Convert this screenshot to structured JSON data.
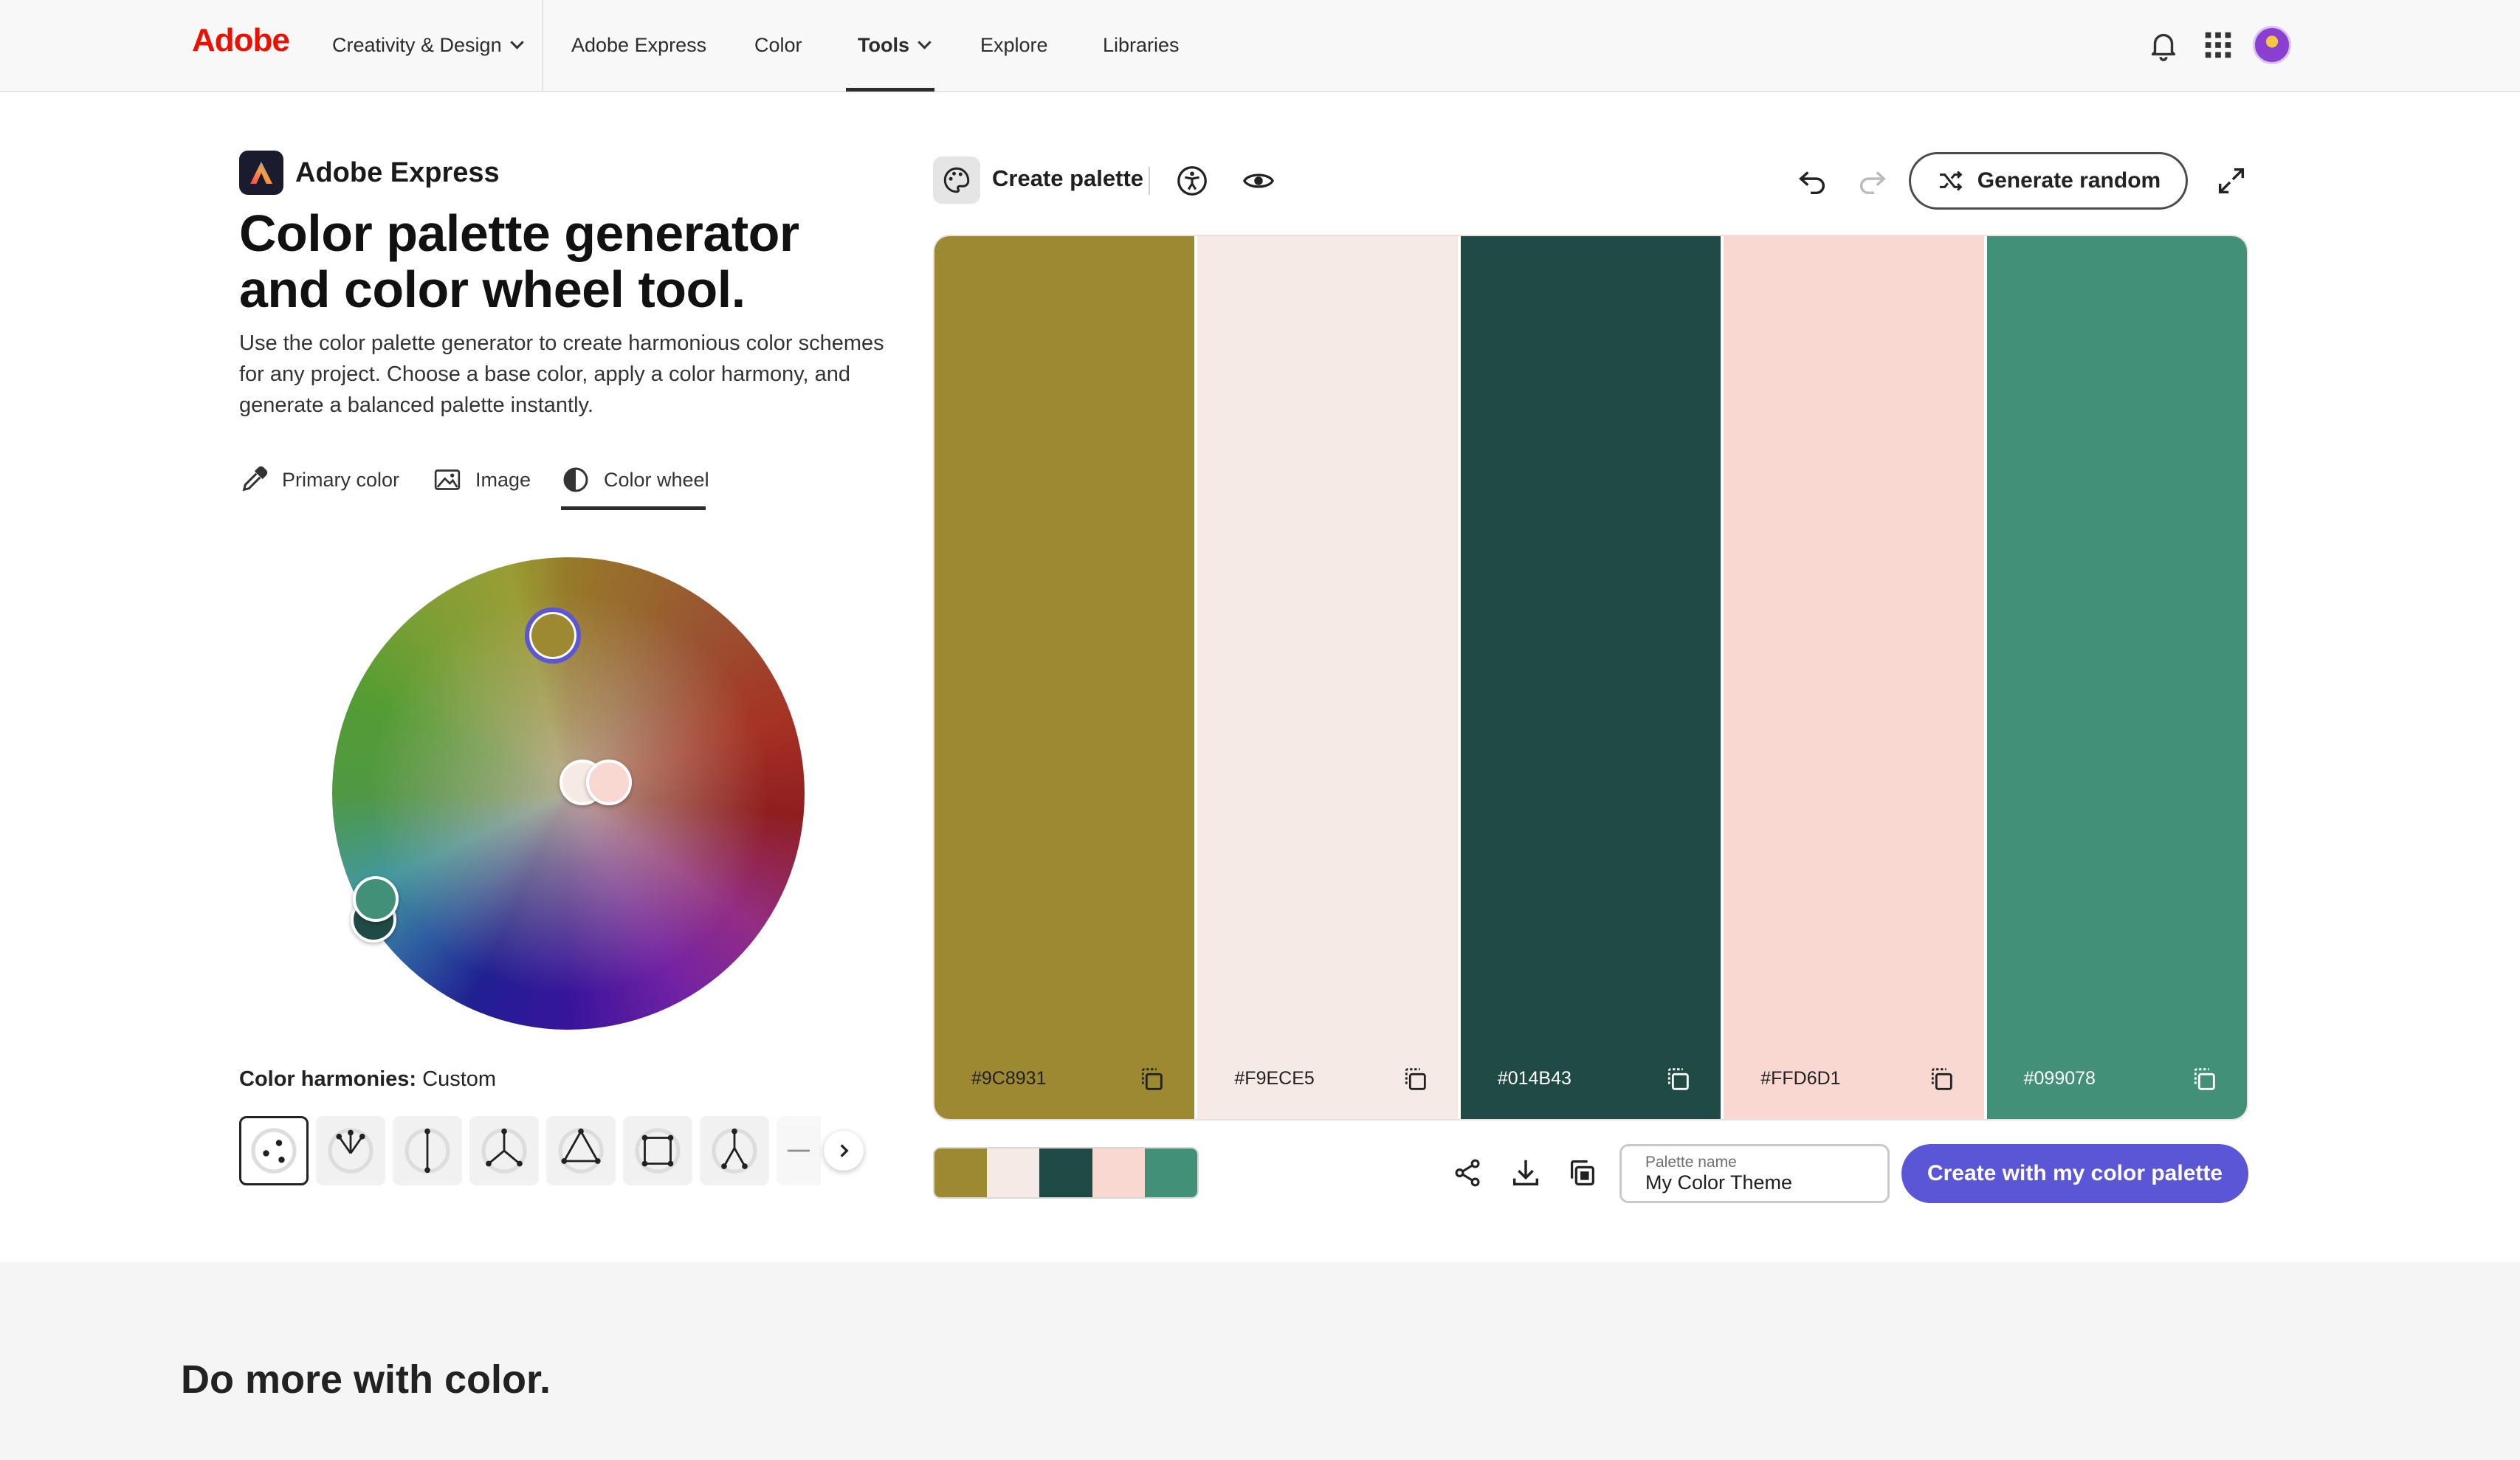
{
  "nav": {
    "logo": "Adobe",
    "items": [
      "Creativity & Design",
      "Adobe Express",
      "Color",
      "Tools",
      "Explore",
      "Libraries"
    ],
    "active": "Tools"
  },
  "brand": {
    "name": "Adobe Express"
  },
  "headline": {
    "line1": "Color palette generator",
    "line2": "and color wheel tool."
  },
  "intro": "Use the color palette generator to create harmonious color schemes for any project. Choose a base color, apply a color harmony, and generate a balanced palette instantly.",
  "tabs": [
    "Primary color",
    "Image",
    "Color wheel"
  ],
  "active_tab": "Color wheel",
  "harmony": {
    "label": "Color harmonies:",
    "value": "Custom"
  },
  "toolbar": {
    "create_label": "Create palette",
    "generate_label": "Generate random"
  },
  "palette": [
    {
      "hex": "#9C8931",
      "color": "#9C8931",
      "text": "#222222"
    },
    {
      "hex": "#F9ECE5",
      "color": "#F6EAE4",
      "text": "#222222"
    },
    {
      "hex": "#014B43",
      "color": "#204B45",
      "text": "#ffffff"
    },
    {
      "hex": "#FFD6D1",
      "color": "#F9D8D2",
      "text": "#222222"
    },
    {
      "hex": "#099078",
      "color": "#429078",
      "text": "#ffffff"
    }
  ],
  "palette_name": {
    "label": "Palette name",
    "value": "My Color Theme"
  },
  "create_button": "Create with my color palette",
  "lower": {
    "title": "Do more with color."
  }
}
